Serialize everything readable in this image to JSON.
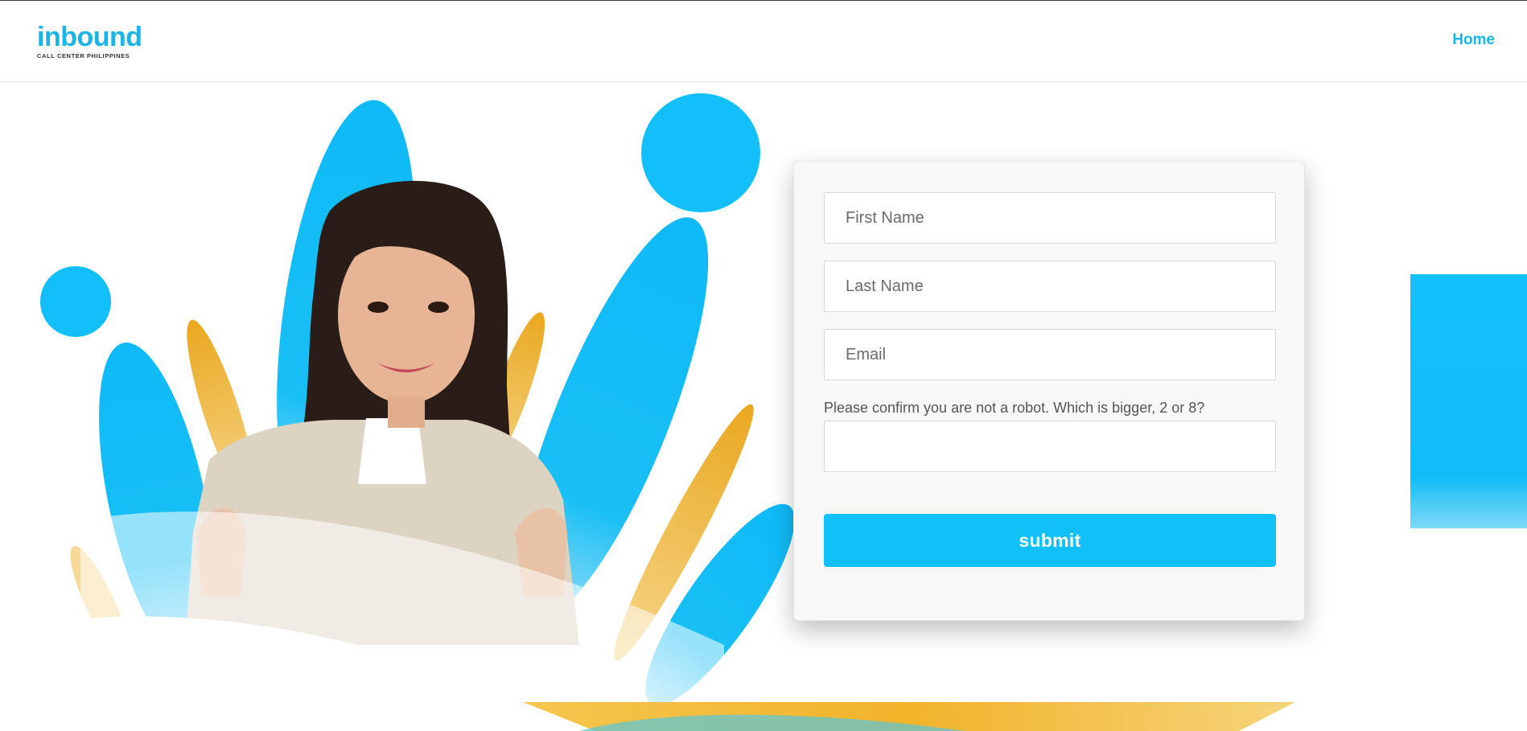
{
  "header": {
    "logo_word": "inbound",
    "logo_tagline": "CALL CENTER PHILIPPINES",
    "nav_home": "Home"
  },
  "form": {
    "first_name_placeholder": "First Name",
    "last_name_placeholder": "Last Name",
    "email_placeholder": "Email",
    "robot_question": "Please confirm you are not a robot. Which is bigger, 2 or 8?",
    "robot_value": "",
    "submit_label": "submit"
  },
  "colors": {
    "brand_blue": "#12c0f8",
    "accent_yellow": "#f0b323"
  },
  "icons": {
    "hero_image": "smiling-woman-thumbs-up-illustration"
  }
}
